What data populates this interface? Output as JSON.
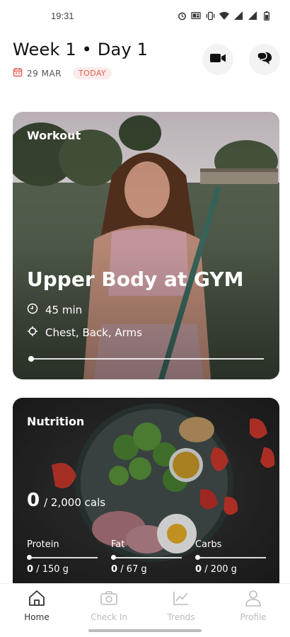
{
  "status_bar": {
    "time": "19:31",
    "icons": [
      "alarm-icon",
      "cast-icon",
      "vibrate-icon",
      "wifi-icon",
      "signal-icon",
      "signal-icon",
      "battery-icon"
    ]
  },
  "header": {
    "title": "Week 1 • Day 1",
    "date": "29 MAR",
    "today_badge": "TODAY",
    "calendar_icon": "calendar-icon",
    "video_button_icon": "video-camera-icon",
    "chat_button_icon": "chat-bubbles-icon"
  },
  "workout": {
    "label": "Workout",
    "title": "Upper Body at GYM",
    "duration": "45 min",
    "focus": "Chest, Back, Arms",
    "progress": 0,
    "duration_icon": "clock-icon",
    "focus_icon": "target-icon"
  },
  "nutrition": {
    "label": "Nutrition",
    "calories_value": "0",
    "calories_total": "/ 2,000 cals",
    "macros": [
      {
        "name": "Protein",
        "value": "0",
        "total": "/ 150 g",
        "progress": 0
      },
      {
        "name": "Fat",
        "value": "0",
        "total": "/ 67 g",
        "progress": 0
      },
      {
        "name": "Carbs",
        "value": "0",
        "total": "/ 200 g",
        "progress": 0
      }
    ]
  },
  "bottom_nav": {
    "items": [
      {
        "label": "Home",
        "icon": "home-icon",
        "active": true
      },
      {
        "label": "Check In",
        "icon": "camera-icon",
        "active": false
      },
      {
        "label": "Trends",
        "icon": "trend-chart-icon",
        "active": false
      },
      {
        "label": "Profile",
        "icon": "person-icon",
        "active": false
      }
    ]
  },
  "colors": {
    "accent_red": "#e06050",
    "badge_bg": "#fbeceb",
    "text_dark": "#111111",
    "nav_inactive": "#bbbbbb"
  }
}
